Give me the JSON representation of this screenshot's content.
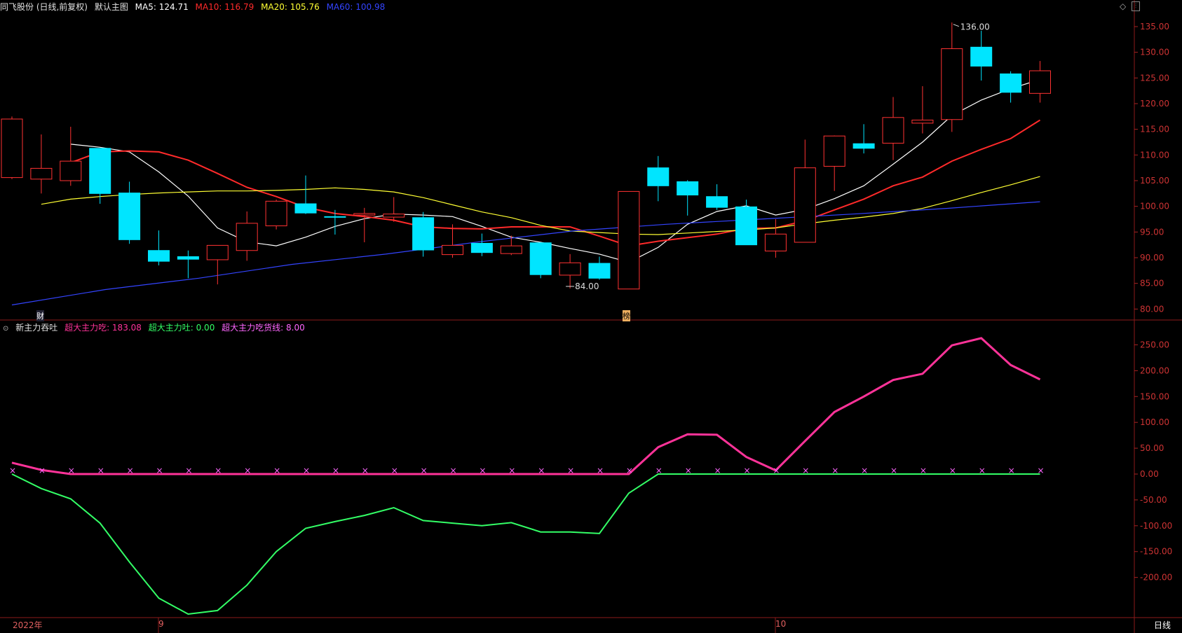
{
  "header": {
    "stock_title": "同飞股份 (日线,前复权)",
    "main_chart_label": "默认主图",
    "ma": [
      {
        "label": "MA5: 124.71",
        "color": "#ffffff"
      },
      {
        "label": "MA10: 116.79",
        "color": "#ff2a2a"
      },
      {
        "label": "MA20: 105.76",
        "color": "#ffff33"
      },
      {
        "label": "MA60: 100.98",
        "color": "#3344ff"
      }
    ]
  },
  "indicator_header": {
    "name": "新主力吞吐",
    "items": [
      {
        "label": "超大主力吃: 183.08",
        "color": "#ff3399"
      },
      {
        "label": "超大主力吐: 0.00",
        "color": "#33ff66"
      },
      {
        "label": "超大主力吃货线: 8.00",
        "color": "#ff66ff"
      }
    ]
  },
  "footer": {
    "year_label": "2022年",
    "month_9": "9",
    "month_10": "10",
    "period_tab": "日线"
  },
  "markers": {
    "fin": "财",
    "bang": "榜",
    "high_label": "136.00",
    "low_label": "84.00"
  },
  "chart_data": [
    {
      "type": "candlestick",
      "ylim": [
        78,
        138
      ],
      "y_ticks": [
        "135.00",
        "130.00",
        "125.00",
        "120.00",
        "115.00",
        "110.00",
        "105.00",
        "100.00",
        "95.00",
        "90.00",
        "85.00",
        "80.00"
      ],
      "candles": [
        {
          "o": 105.6,
          "c": 117.0,
          "h": 117.5,
          "l": 105.3
        },
        {
          "o": 105.3,
          "c": 107.4,
          "h": 114.0,
          "l": 102.5
        },
        {
          "o": 105.0,
          "c": 108.8,
          "h": 115.5,
          "l": 104.0
        },
        {
          "o": 111.3,
          "c": 102.5,
          "h": 111.3,
          "l": 100.5
        },
        {
          "o": 102.6,
          "c": 93.5,
          "h": 104.8,
          "l": 92.7
        },
        {
          "o": 91.4,
          "c": 89.3,
          "h": 95.3,
          "l": 88.5
        },
        {
          "o": 90.2,
          "c": 89.7,
          "h": 91.4,
          "l": 86.0
        },
        {
          "o": 89.6,
          "c": 92.4,
          "h": 92.4,
          "l": 84.8
        },
        {
          "o": 91.4,
          "c": 96.7,
          "h": 99.0,
          "l": 89.4
        },
        {
          "o": 96.2,
          "c": 101.0,
          "h": 101.3,
          "l": 95.5
        },
        {
          "o": 100.5,
          "c": 98.7,
          "h": 106.0,
          "l": 98.5
        },
        {
          "o": 98.0,
          "c": 97.9,
          "h": 99.3,
          "l": 94.5
        },
        {
          "o": 98.3,
          "c": 98.6,
          "h": 99.7,
          "l": 93.0
        },
        {
          "o": 97.9,
          "c": 98.5,
          "h": 101.8,
          "l": 97.0
        },
        {
          "o": 97.8,
          "c": 91.5,
          "h": 98.9,
          "l": 90.2
        },
        {
          "o": 90.6,
          "c": 92.4,
          "h": 96.5,
          "l": 90.0
        },
        {
          "o": 92.8,
          "c": 91.0,
          "h": 94.7,
          "l": 90.3
        },
        {
          "o": 90.8,
          "c": 92.3,
          "h": 94.3,
          "l": 90.5
        },
        {
          "o": 92.9,
          "c": 86.7,
          "h": 93.0,
          "l": 86.0
        },
        {
          "o": 86.6,
          "c": 89.0,
          "h": 90.7,
          "l": 84.0
        },
        {
          "o": 88.9,
          "c": 86.0,
          "h": 90.2,
          "l": 85.7
        },
        {
          "o": 83.9,
          "c": 102.9,
          "h": 102.9,
          "l": 83.9
        },
        {
          "o": 107.5,
          "c": 104.0,
          "h": 109.8,
          "l": 101.0
        },
        {
          "o": 104.8,
          "c": 102.2,
          "h": 105.1,
          "l": 98.2
        },
        {
          "o": 101.9,
          "c": 99.8,
          "h": 104.3,
          "l": 99.3
        },
        {
          "o": 99.9,
          "c": 92.5,
          "h": 101.3,
          "l": 92.5
        },
        {
          "o": 91.3,
          "c": 94.6,
          "h": 97.5,
          "l": 90.0
        },
        {
          "o": 93.0,
          "c": 107.5,
          "h": 113.0,
          "l": 93.0
        },
        {
          "o": 107.8,
          "c": 113.7,
          "h": 113.8,
          "l": 103.0
        },
        {
          "o": 112.2,
          "c": 111.3,
          "h": 116.0,
          "l": 110.3
        },
        {
          "o": 112.3,
          "c": 117.3,
          "h": 121.3,
          "l": 109.0
        },
        {
          "o": 116.2,
          "c": 116.8,
          "h": 123.4,
          "l": 114.2
        },
        {
          "o": 116.9,
          "c": 130.7,
          "h": 135.8,
          "l": 114.5
        },
        {
          "o": 131.0,
          "c": 127.3,
          "h": 134.2,
          "l": 124.5
        },
        {
          "o": 125.8,
          "c": 122.2,
          "h": 126.3,
          "l": 120.2
        },
        {
          "o": 122.0,
          "c": 126.4,
          "h": 128.3,
          "l": 120.2
        }
      ],
      "ma_series": [
        {
          "name": "MA5",
          "color": "#ffffff",
          "values": [
            112.1,
            111.5,
            110.6,
            106.7,
            102.0,
            95.8,
            93.1,
            92.3,
            94.0,
            96.1,
            97.6,
            98.5,
            98.3,
            98.0,
            96.1,
            94.0,
            93.0,
            91.8,
            90.7,
            89.1,
            92.0,
            96.5,
            99.0,
            100.1,
            98.3,
            99.4,
            101.5,
            104.0,
            108.2,
            112.5,
            117.7,
            120.7,
            122.9,
            124.7
          ]
        },
        {
          "name": "MA10",
          "color": "#ff2a2a",
          "values": [
            108.5,
            110.6,
            110.8,
            110.6,
            109.0,
            106.4,
            103.7,
            101.9,
            99.8,
            98.6,
            98.0,
            97.3,
            96.0,
            95.7,
            95.6,
            96.0,
            96.0,
            96.0,
            94.2,
            92.3,
            93.2,
            93.9,
            94.6,
            95.7,
            95.8,
            97.2,
            99.3,
            101.4,
            104.0,
            105.7,
            108.8,
            111.1,
            113.2,
            116.8
          ]
        },
        {
          "name": "MA20",
          "color": "#ffff33",
          "values": [
            100.4,
            101.4,
            101.9,
            102.3,
            102.6,
            102.8,
            103.0,
            103.0,
            103.1,
            103.3,
            103.6,
            103.3,
            102.8,
            101.7,
            100.3,
            98.9,
            97.8,
            96.3,
            95.2,
            94.9,
            94.6,
            94.5,
            94.8,
            95.1,
            95.4,
            95.8,
            96.6,
            97.3,
            97.9,
            98.6,
            99.6,
            101.1,
            102.7,
            104.2,
            105.8
          ]
        },
        {
          "name": "MA60",
          "color": "#3344ff",
          "values": [
            80.8,
            83.8,
            86.0,
            88.7,
            90.7,
            93.1,
            95.2,
            96.5,
            97.5,
            98.5,
            99.6,
            100.9
          ]
        }
      ]
    },
    {
      "type": "line",
      "title": "新主力吞吐",
      "ylim": [
        -275,
        275
      ],
      "y_ticks": [
        "250.00",
        "200.00",
        "150.00",
        "100.00",
        "50.00",
        "0.00",
        "-50.00",
        "-100.00",
        "-150.00",
        "-200.00"
      ],
      "series": [
        {
          "name": "超大主力吃",
          "color": "#ff3399",
          "values": [
            22,
            8,
            0,
            0,
            0,
            0,
            0,
            0,
            0,
            0,
            0,
            0,
            0,
            0,
            0,
            0,
            0,
            0,
            0,
            0,
            0,
            0,
            52,
            77,
            76,
            33,
            7,
            64,
            120,
            150,
            182,
            194,
            249,
            263,
            211,
            183
          ]
        },
        {
          "name": "超大主力吐",
          "color": "#33ff66",
          "values": [
            0,
            -28,
            -48,
            -95,
            -170,
            -240,
            -271,
            -264,
            -215,
            -150,
            -105,
            -92,
            -80,
            -65,
            -90,
            -95,
            -100,
            -94,
            -112,
            -112,
            -115,
            -37,
            0,
            0,
            0,
            0,
            0,
            0,
            0,
            0,
            0,
            0,
            0,
            0,
            0,
            0
          ]
        },
        {
          "name": "超大主力吃货线",
          "color": "#ff66ff",
          "values": [
            8,
            8,
            8,
            8,
            8,
            8,
            8,
            8,
            8,
            8,
            8,
            8,
            8,
            8,
            8,
            8,
            8,
            8,
            8,
            8,
            8,
            8,
            8,
            8,
            8,
            8,
            8,
            8,
            8,
            8,
            8,
            8,
            8,
            8,
            8,
            8
          ]
        }
      ]
    }
  ]
}
